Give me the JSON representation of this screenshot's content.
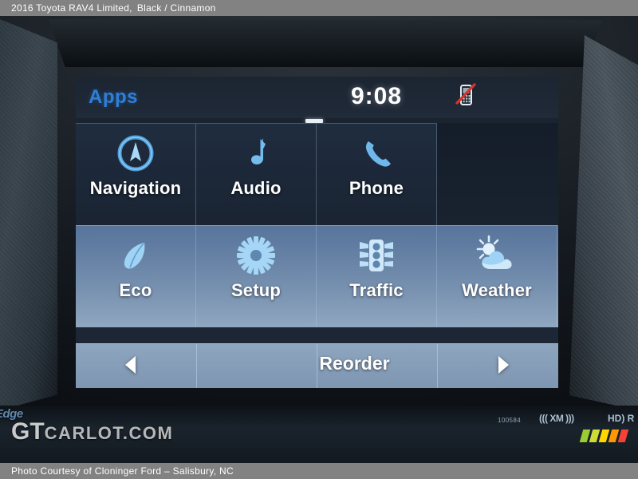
{
  "watermark": {
    "top_title": "2016 Toyota RAV4 Limited,",
    "top_trim": "Black / Cinnamon",
    "brand": "GTCARLOT.COM",
    "brand_big": "GT",
    "brand_small": "CARLOT.COM",
    "bottom_credit": "Photo Courtesy of Cloninger Ford – Salisbury, NC"
  },
  "colors": {
    "accent_blue": "#2f7fd8",
    "icon_blue": "#79b7e8",
    "row2_blue": "#8ea6bf",
    "text_white": "#ffffff",
    "alert_red": "#d5342b",
    "watermark_bar": "#828282"
  },
  "head_unit": {
    "edge_logo": "Edge",
    "model_number": "100584",
    "xm_logo": "((( XM )))",
    "hd_radio_logo": "HD) R"
  },
  "screen": {
    "title": "Apps",
    "clock": "9:08",
    "status_icon": "phone-disconnected-icon",
    "page_indicator": "page-1-of-1",
    "tiles": [
      {
        "label": "Navigation",
        "icon": "compass-icon"
      },
      {
        "label": "Audio",
        "icon": "music-note-icon"
      },
      {
        "label": "Phone",
        "icon": "phone-handset-icon"
      },
      {
        "label": "",
        "icon": "empty-slot"
      },
      {
        "label": "Eco",
        "icon": "leaf-icon"
      },
      {
        "label": "Setup",
        "icon": "gear-icon"
      },
      {
        "label": "Traffic",
        "icon": "traffic-light-icon"
      },
      {
        "label": "Weather",
        "icon": "sun-cloud-icon"
      }
    ],
    "nav": {
      "prev": "◀",
      "reorder": "Reorder",
      "next": "▶"
    }
  }
}
